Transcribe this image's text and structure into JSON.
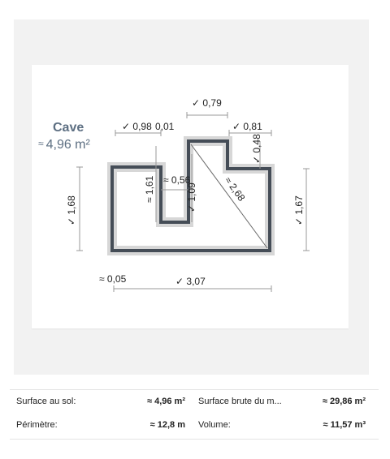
{
  "room": {
    "name": "Cave",
    "approx_symbol": "≈",
    "area": "4,96 m²"
  },
  "dimensions": {
    "top_079": "✓ 0,79",
    "top_098": "✓ 0,98",
    "top_001": "0,01",
    "top_081": "✓ 0,81",
    "right_048": "✓ 0,48",
    "left_161": "≈ 1,61",
    "mid_056": "≈ 0,56",
    "mid_109": "✓ 1,09",
    "diag_268": "≈ 2,68",
    "outer_left_168": "✓ 1,68",
    "outer_right_167": "✓ 1,67",
    "bottom_005": "≈ 0,05",
    "bottom_307": "✓ 3,07"
  },
  "stats": {
    "floor_area_label": "Surface au sol:",
    "floor_area_value": "≈ 4,96 m²",
    "gross_area_label": "Surface brute du m...",
    "gross_area_value": "≈ 29,86 m²",
    "perimeter_label": "Périmètre:",
    "perimeter_value": "≈ 12,8 m",
    "volume_label": "Volume:",
    "volume_value": "≈ 11,57 m³"
  }
}
